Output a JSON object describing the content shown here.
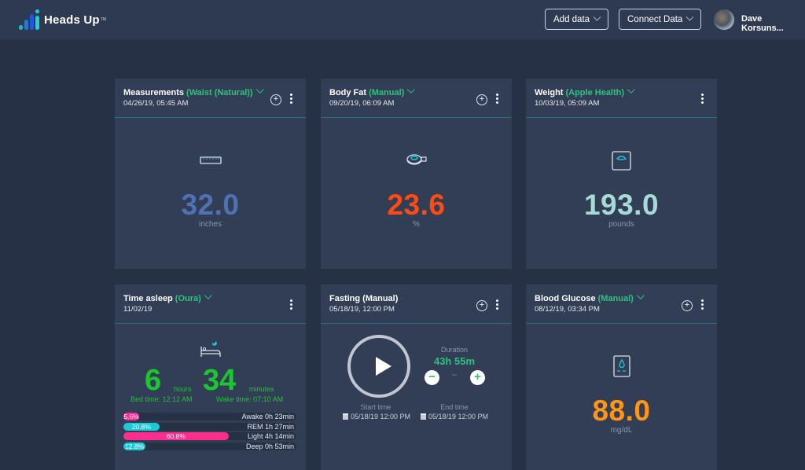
{
  "app": {
    "name": "Heads Up",
    "tm": "TM"
  },
  "header": {
    "add_data": "Add data",
    "connect_data": "Connect Data",
    "user_name": "Dave Korsuns..."
  },
  "colors": {
    "accent_green": "#2ec27e",
    "measurement_blue": "#4e72b3",
    "bodyfat_orange": "#ff4a14",
    "weight_teal": "#a6dbd6",
    "sleep_green": "#1ec532",
    "glucose_orange": "#ff9417",
    "pink": "#ff2e8e",
    "cyan": "#1dc8d8"
  },
  "cards": {
    "measurements": {
      "title": "Measurements",
      "source": "(Waist (Natural))",
      "date": "04/26/19, 05:45 AM",
      "value": "32.0",
      "unit": "inches",
      "icon": "ruler-icon"
    },
    "body_fat": {
      "title": "Body Fat",
      "source": "(Manual)",
      "date": "09/20/19, 06:09 AM",
      "value": "23.6",
      "unit": "%",
      "icon": "tape-measure-icon"
    },
    "weight": {
      "title": "Weight",
      "source": "(Apple Health)",
      "date": "10/03/19, 05:09 AM",
      "value": "193.0",
      "unit": "pounds",
      "icon": "scale-icon"
    },
    "sleep": {
      "title": "Time asleep",
      "source": "(Oura)",
      "date": "11/02/19",
      "hours": "6",
      "hours_label": "hours",
      "minutes": "34",
      "minutes_label": "minutes",
      "bed_time": "Bed time: 12:12 AM",
      "wake_time": "Wake time: 07:10 AM",
      "stages": [
        {
          "pct_label": "5.6%",
          "percent": 5.6,
          "label": "Awake 0h 23min",
          "color": "#ff2e8e"
        },
        {
          "pct_label": "20.8%",
          "percent": 20.8,
          "label": "REM 1h 27min",
          "color": "#1dc8d8"
        },
        {
          "pct_label": "60.8%",
          "percent": 60.8,
          "label": "Light 4h 14min",
          "color": "#ff2e8e"
        },
        {
          "pct_label": "12.8%",
          "percent": 12.8,
          "label": "Deep 0h 53min",
          "color": "#1dc8d8"
        }
      ]
    },
    "fasting": {
      "title": "Fasting (Manual)",
      "date": "05/18/19, 12:00 PM",
      "duration_label": "Duration",
      "duration": "43h 55m",
      "adjust_value": "--",
      "start_label": "Start time",
      "start_value": "05/18/19 12:00 PM",
      "end_label": "End time",
      "end_value": "05/18/19 12:00 PM"
    },
    "glucose": {
      "title": "Blood Glucose",
      "source": "(Manual)",
      "date": "08/12/19, 03:34 PM",
      "value": "88.0",
      "unit": "mg/dL",
      "icon": "glucose-meter-icon"
    }
  }
}
